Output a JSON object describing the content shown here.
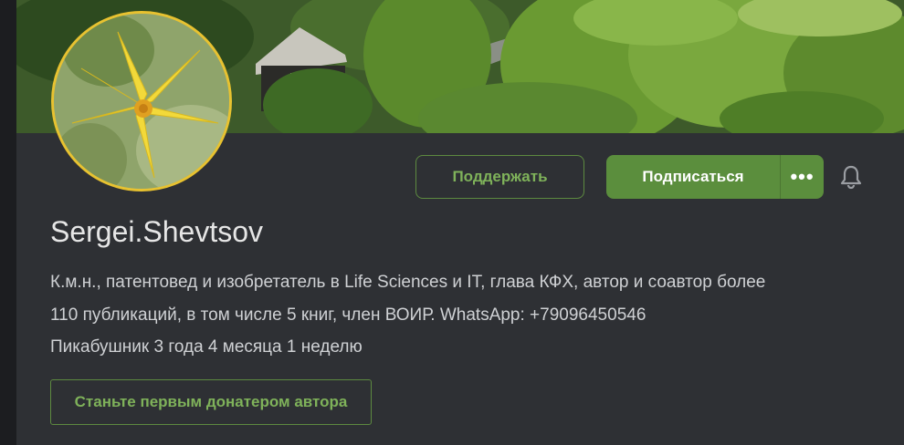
{
  "profile": {
    "username": "Sergei.Shevtsov",
    "bio_line1": "К.м.н., патентовед и изобретатель в Life Sciences и IT, глава КФХ, автор и соавтор более",
    "bio_line2": "110 публикаций, в том числе 5 книг, член ВОИР. WhatsApp: +79096450546",
    "tenure": "Пикабушник 3 года 4 месяца 1 неделю"
  },
  "actions": {
    "support_label": "Поддержать",
    "subscribe_label": "Подписаться",
    "more_label": "•••",
    "donate_label": "Станьте первым донатером автора"
  },
  "icons": {
    "bell": "bell-icon",
    "more": "more-dots-icon"
  },
  "colors": {
    "accent_green": "#5b8e3d",
    "accent_green_text": "#7fb25a",
    "avatar_border": "#e8c230",
    "background": "#2e3034"
  }
}
